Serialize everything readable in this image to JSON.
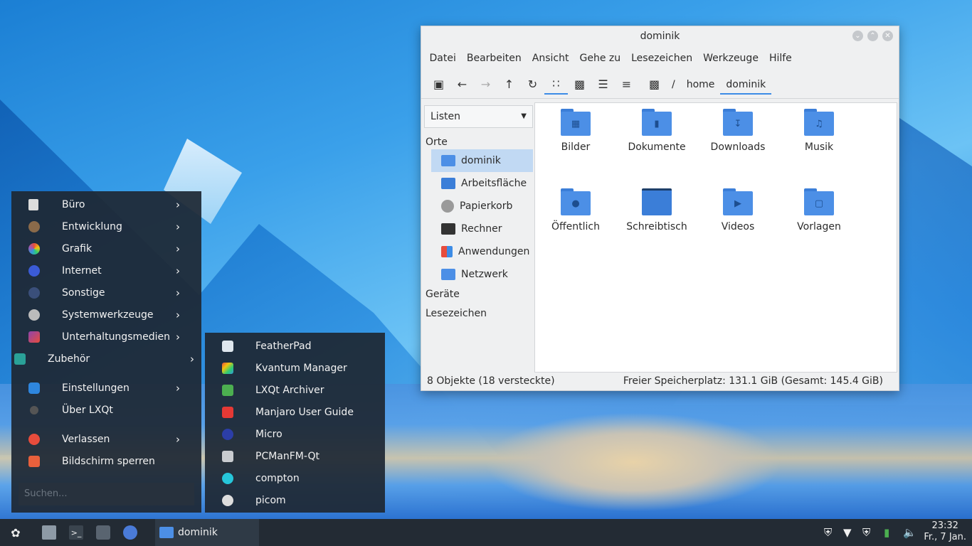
{
  "file_manager": {
    "title": "dominik",
    "menu": [
      "Datei",
      "Bearbeiten",
      "Ansicht",
      "Gehe zu",
      "Lesezeichen",
      "Werkzeuge",
      "Hilfe"
    ],
    "breadcrumb": [
      "/",
      "home",
      "dominik"
    ],
    "side_mode": "Listen",
    "sections": {
      "places": "Orte",
      "devices": "Geräte",
      "bookmarks": "Lesezeichen"
    },
    "places": [
      "dominik",
      "Arbeitsfläche",
      "Papierkorb",
      "Rechner",
      "Anwendungen",
      "Netzwerk"
    ],
    "files": [
      "Bilder",
      "Dokumente",
      "Downloads",
      "Musik",
      "Öffentlich",
      "Schreibtisch",
      "Videos",
      "Vorlagen"
    ],
    "status_left": "8 Objekte (18 versteckte)",
    "status_right": "Freier Speicherplatz: 131.1 GiB (Gesamt: 145.4 GiB)"
  },
  "start_menu": {
    "items": [
      "Büro",
      "Entwicklung",
      "Grafik",
      "Internet",
      "Sonstige",
      "Systemwerkzeuge",
      "Unterhaltungsmedien",
      "Zubehör",
      "Einstellungen",
      "Über LXQt",
      "Verlassen",
      "Bildschirm sperren"
    ],
    "search_placeholder": "Suchen..."
  },
  "submenu": {
    "items": [
      "FeatherPad",
      "Kvantum Manager",
      "LXQt Archiver",
      "Manjaro User Guide",
      "Micro",
      "PCManFM-Qt",
      "compton",
      "picom"
    ]
  },
  "panel": {
    "task_label": "dominik",
    "time": "23:32",
    "date": "Fr., 7 Jan."
  }
}
